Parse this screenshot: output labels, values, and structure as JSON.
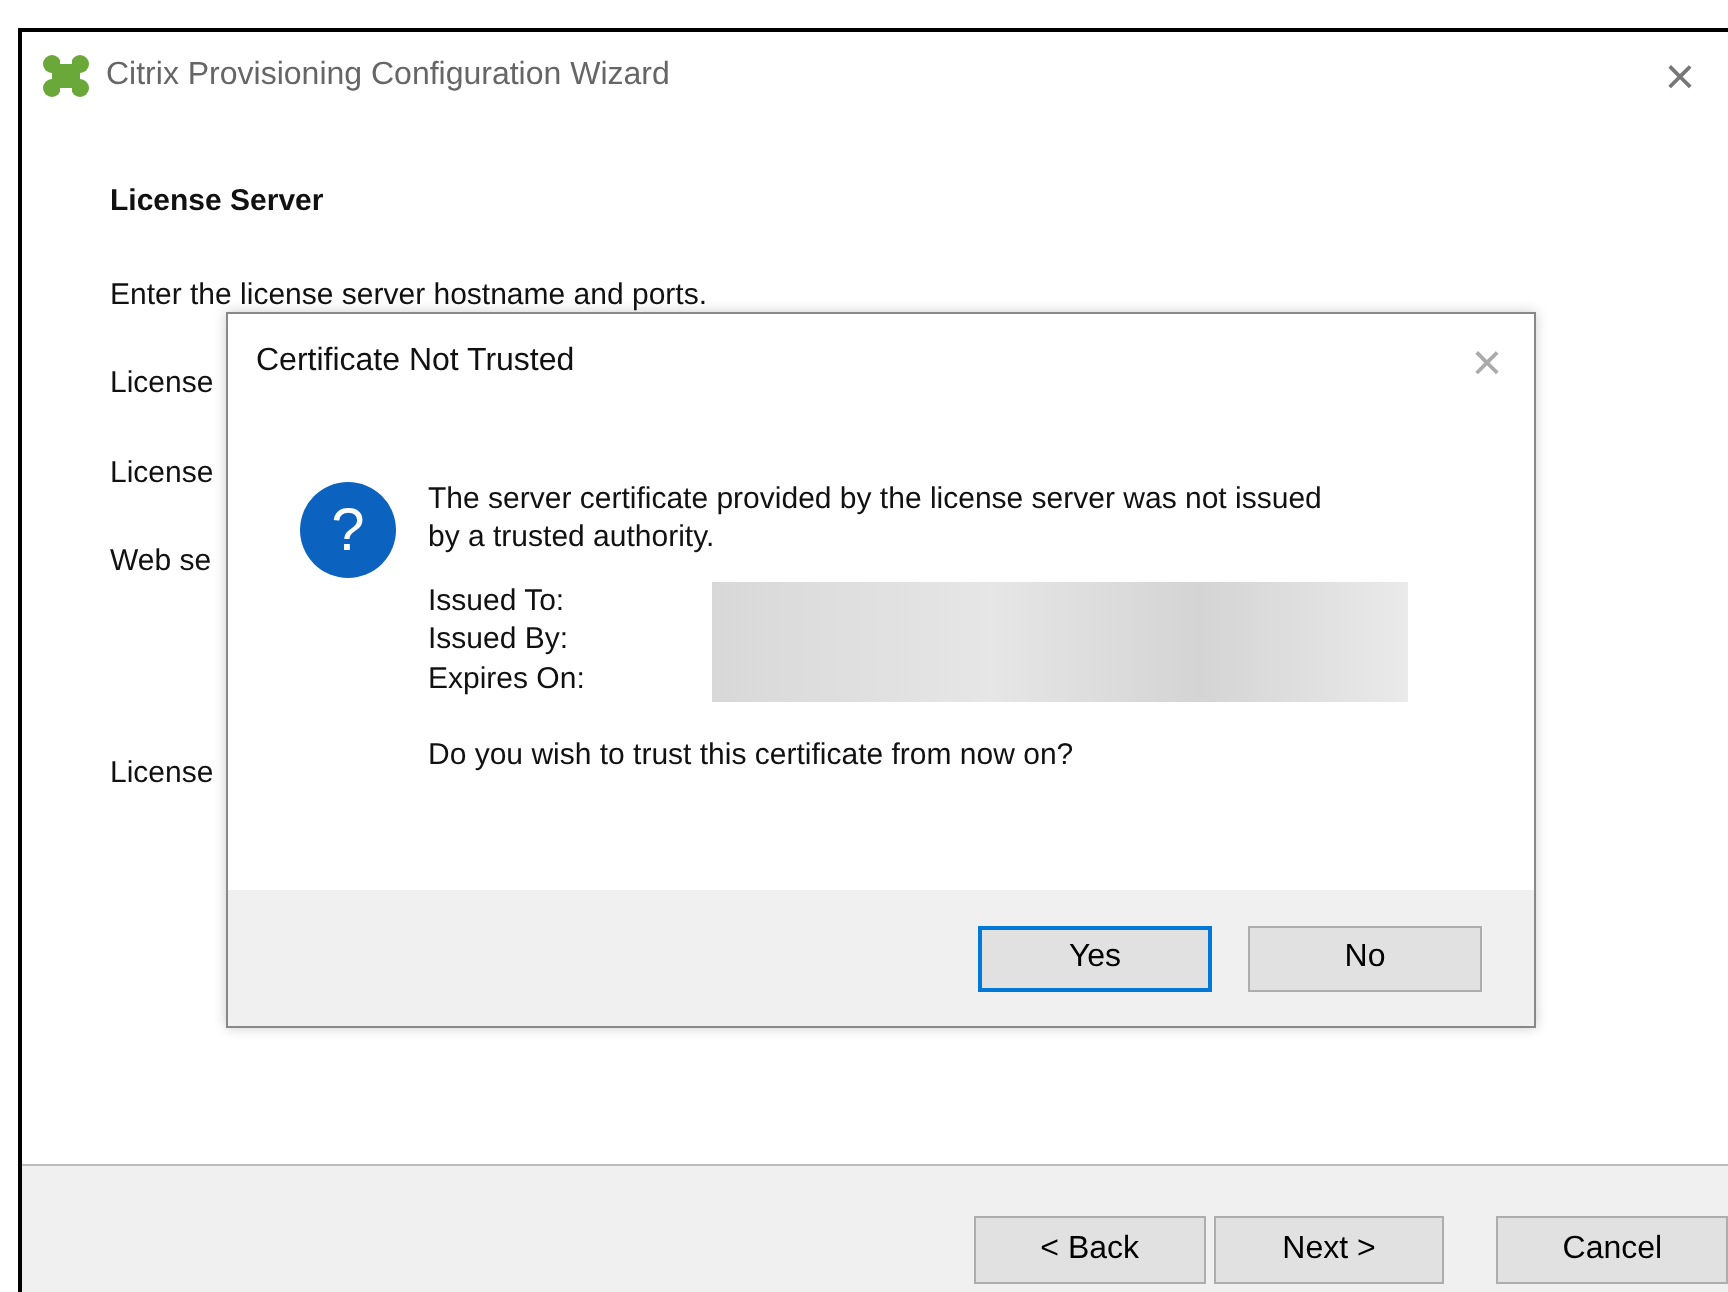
{
  "window": {
    "title": "Citrix Provisioning Configuration Wizard",
    "close": "×"
  },
  "page": {
    "heading": "License Server",
    "instruction": "Enter the license server hostname and ports.",
    "labels": [
      "License",
      "License",
      "Web se"
    ],
    "bottom_label": "License"
  },
  "footer_buttons": [
    {
      "label": "< Back",
      "kind": "back"
    },
    {
      "label": "Next >",
      "kind": "next"
    },
    {
      "label": "Cancel",
      "kind": "cancel"
    }
  ],
  "dialog": {
    "title": "Certificate Not Trusted",
    "close": "×",
    "icon": "?",
    "message": "The server certificate provided by the license server was not issued by a trusted authority.",
    "fields": [
      "Issued To:",
      "Issued By:",
      "Expires On:"
    ],
    "question": "Do you wish to trust this certificate from now on?",
    "buttons": [
      {
        "label": "Yes",
        "selected": true
      },
      {
        "label": "No",
        "selected": false
      }
    ]
  }
}
